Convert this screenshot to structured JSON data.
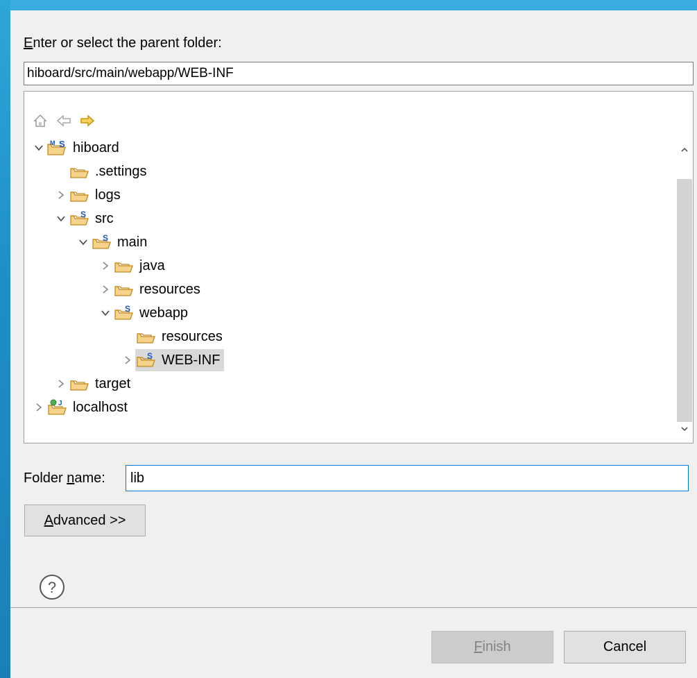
{
  "dialog": {
    "parent_folder_label": "Enter or select the parent folder:",
    "parent_folder_value": "hiboard/src/main/webapp/WEB-INF",
    "folder_name_label": "Folder name:",
    "folder_name_value": "lib",
    "advanced_label": "Advanced >>",
    "finish_label": "Finish",
    "cancel_label": "Cancel"
  },
  "tree": {
    "items": [
      {
        "label": "hiboard",
        "expanded": true,
        "icon": "maven-project-folder-icon"
      },
      {
        "label": ".settings",
        "icon": "folder-icon"
      },
      {
        "label": "logs",
        "expanded": false,
        "icon": "folder-icon"
      },
      {
        "label": "src",
        "expanded": true,
        "icon": "source-folder-icon"
      },
      {
        "label": "main",
        "expanded": true,
        "icon": "source-folder-icon"
      },
      {
        "label": "java",
        "expanded": false,
        "icon": "folder-icon"
      },
      {
        "label": "resources",
        "expanded": false,
        "icon": "folder-icon"
      },
      {
        "label": "webapp",
        "expanded": true,
        "icon": "source-folder-icon"
      },
      {
        "label": "resources",
        "icon": "folder-icon"
      },
      {
        "label": "WEB-INF",
        "expanded": false,
        "icon": "source-folder-icon",
        "selected": true
      },
      {
        "label": "target",
        "expanded": false,
        "icon": "folder-icon"
      },
      {
        "label": "localhost",
        "expanded": false,
        "icon": "server-project-icon"
      }
    ]
  },
  "colors": {
    "dialog_bg": "#f0f0f0",
    "selected_row": "#d9d9d9",
    "focus_border": "#0078d7",
    "folder_fill": "#f5d38a",
    "folder_stroke": "#c08a20",
    "source_marker": "#1e56c8"
  }
}
